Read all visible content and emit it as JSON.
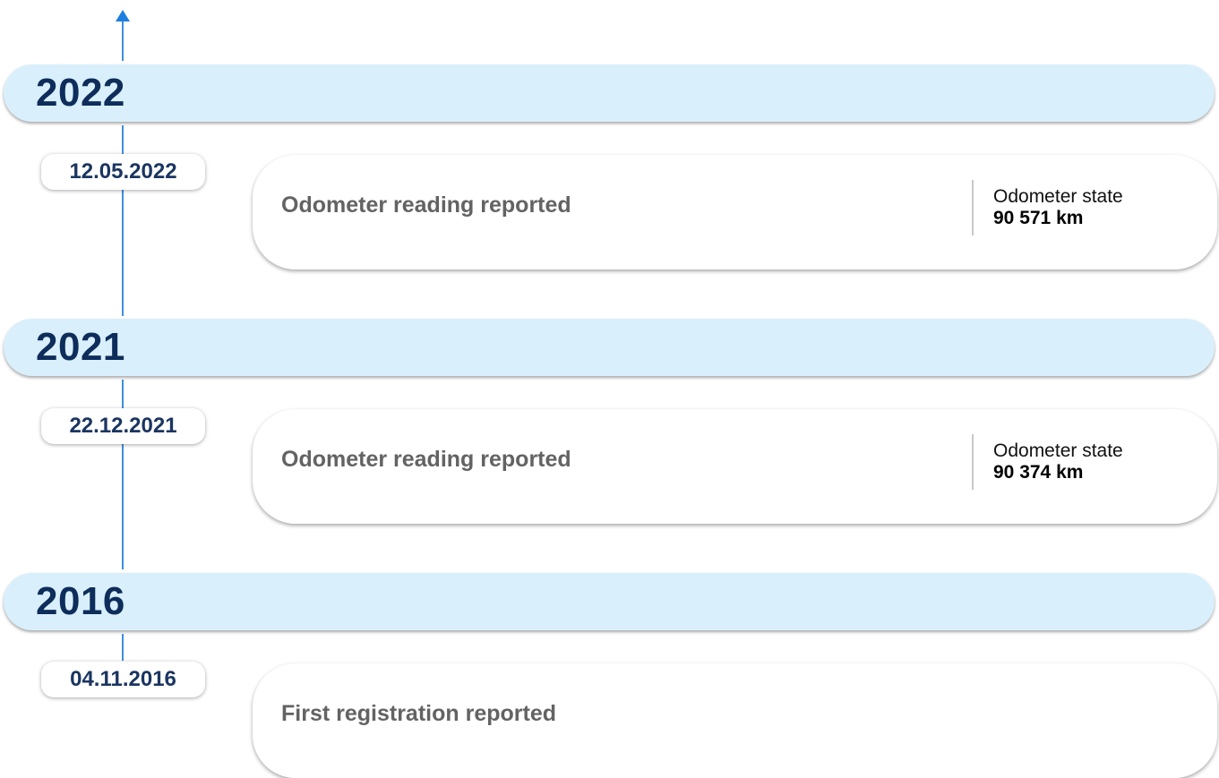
{
  "timeline": {
    "years": [
      {
        "year": "2022",
        "events": [
          {
            "date": "12.05.2022",
            "title": "Odometer reading reported",
            "detail_label": "Odometer state",
            "detail_value": "90 571 km"
          }
        ]
      },
      {
        "year": "2021",
        "events": [
          {
            "date": "22.12.2021",
            "title": "Odometer reading reported",
            "detail_label": "Odometer state",
            "detail_value": "90 374 km"
          }
        ]
      },
      {
        "year": "2016",
        "events": [
          {
            "date": "04.11.2016",
            "title": "First registration reported"
          }
        ]
      }
    ]
  },
  "colors": {
    "axis": "#3f8fe0",
    "year_bar": "#d9f0fc",
    "year_text": "#0e2d5b",
    "date_text": "#1b3560",
    "event_title": "#636363"
  },
  "icons": {
    "axis_arrow": "arrow-up-icon"
  }
}
